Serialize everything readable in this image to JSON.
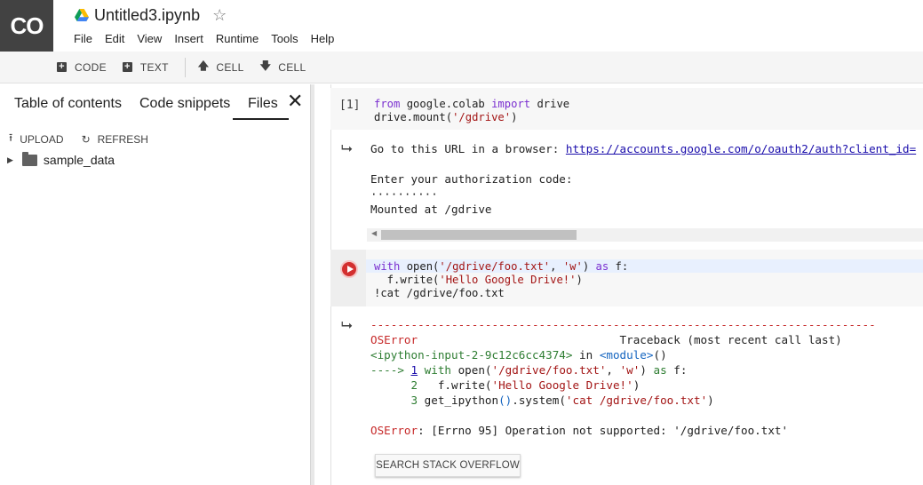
{
  "app": {
    "logo_text": "CO",
    "notebook_title": "Untitled3.ipynb",
    "colors": {
      "logo_bg": "#424242",
      "run_button": "#d32f2f",
      "keyword": "#7b30d0",
      "string": "#a31515",
      "error": "#c62828"
    }
  },
  "menu": [
    "File",
    "Edit",
    "View",
    "Insert",
    "Runtime",
    "Tools",
    "Help"
  ],
  "toolbar": {
    "code_label": "CODE",
    "text_label": "TEXT",
    "cell_up_label": "CELL",
    "cell_down_label": "CELL"
  },
  "sidebar": {
    "tabs": [
      "Table of contents",
      "Code snippets",
      "Files"
    ],
    "active_tab": "Files",
    "upload_label": "UPLOAD",
    "refresh_label": "REFRESH",
    "files": [
      {
        "name": "sample_data",
        "type": "folder"
      }
    ]
  },
  "cells": {
    "cell1": {
      "exec_count": "[1]",
      "code": {
        "l1_a": "from",
        "l1_b": " google.colab ",
        "l1_c": "import",
        "l1_d": " drive",
        "l2_a": "drive.mount(",
        "l2_b": "'/gdrive'",
        "l2_c": ")"
      },
      "output": {
        "url_prefix": "Go to this URL in a browser: ",
        "url": "https://accounts.google.com/o/oauth2/auth?client_id=",
        "prompt": "Enter your authorization code:",
        "masked": "··········",
        "mounted": "Mounted at /gdrive"
      }
    },
    "cell2": {
      "code": {
        "l1_a": "with",
        "l1_b": " open(",
        "l1_c": "'/gdrive/foo.txt'",
        "l1_d": ", ",
        "l1_e": "'w'",
        "l1_f": ") ",
        "l1_g": "as",
        "l1_h": " f:",
        "l2_a": "  f.write(",
        "l2_b": "'Hello Google Drive!'",
        "l2_c": ")",
        "l3": "!cat /gdrive/foo.txt"
      },
      "traceback": {
        "dashes": "---------------------------------------------------------------------------",
        "err_name": "OSError",
        "tb_header": "Traceback (most recent call last)",
        "input_ref_a": "<ipython-input-2-9c12c6cc4374>",
        "input_ref_b": " in ",
        "input_ref_c": "<module>",
        "input_ref_d": "()",
        "arrow": "----> ",
        "line1_num": "1",
        "line1_a": " with",
        "line1_b": " open(",
        "line1_c": "'/gdrive/foo.txt'",
        "line1_d": ", ",
        "line1_e": "'w'",
        "line1_f": ") ",
        "line1_g": "as",
        "line1_h": " f:",
        "line2_num": "      2",
        "line2_a": "   f.write(",
        "line2_b": "'Hello Google Drive!'",
        "line2_c": ")",
        "line3_num": "      3",
        "line3_a": " get_ipython",
        "line3_b": "()",
        "line3_c": ".system(",
        "line3_d": "'cat /gdrive/foo.txt'",
        "line3_e": ")",
        "final_err": "OSError",
        "final_msg": ": [Errno 95] Operation not supported: '/gdrive/foo.txt'"
      },
      "search_button": "SEARCH STACK OVERFLOW"
    }
  }
}
